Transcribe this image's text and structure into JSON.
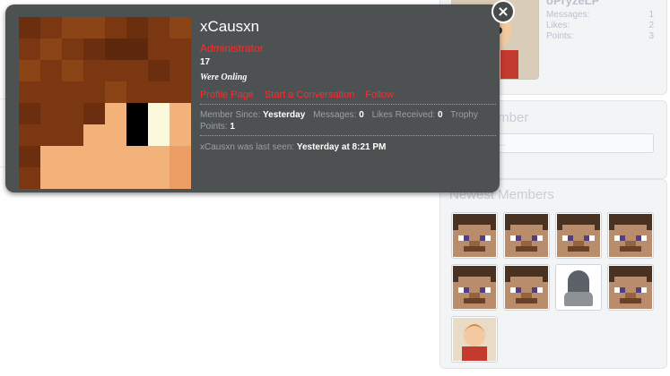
{
  "colors": {
    "overlay_bg": "#4e5152",
    "accent_red": "#ff2a2a",
    "muted_text": "#9aa0a4",
    "sidebar_bg": "#f3f4f6"
  },
  "profile_card": {
    "username": "xCausxn",
    "role": "Administrator",
    "age": "17",
    "status": "Were Onling",
    "links": [
      "Profile Page",
      "Start a Conversation",
      "Follow"
    ],
    "stats": {
      "member_since_label": "Member Since:",
      "member_since_value": "Yesterday",
      "messages_label": "Messages:",
      "messages_value": "0",
      "likes_label": "Likes Received:",
      "likes_value": "0",
      "trophy_label": "Trophy Points:",
      "trophy_value": "1"
    },
    "last_seen_prefix": "xCausxn was last seen:",
    "last_seen_value": "Yesterday at 8:21 PM",
    "close_icon": "close-icon"
  },
  "staff_online": {
    "name": "oPryzeLP",
    "stats": [
      {
        "label": "Messages:",
        "value": "1"
      },
      {
        "label": "Likes:",
        "value": "2"
      },
      {
        "label": "Points:",
        "value": "3"
      }
    ]
  },
  "find_member": {
    "heading": "Find Member",
    "placeholder": "Name..."
  },
  "newest_members": {
    "heading": "Newest Members",
    "avatars": [
      "steve",
      "steve",
      "steve",
      "steve",
      "steve",
      "steve",
      "darth-vader",
      "steve",
      "cartoon-boy"
    ]
  },
  "background_numbers": {
    "big": "1"
  }
}
